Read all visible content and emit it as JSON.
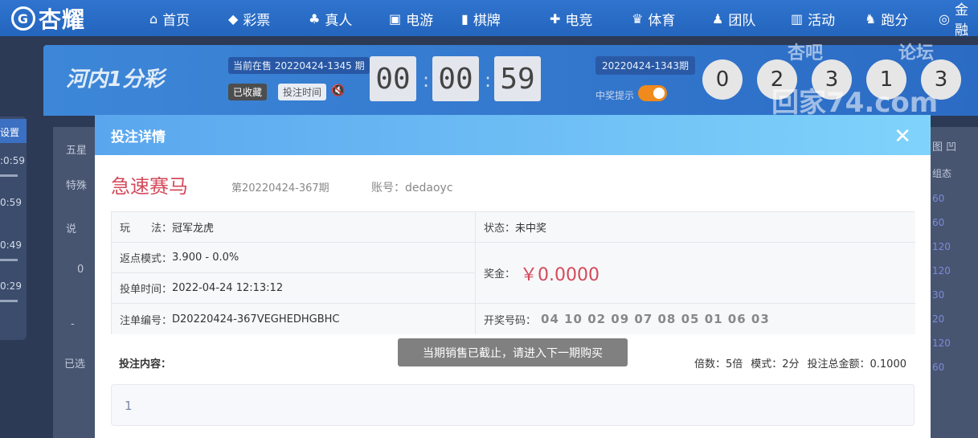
{
  "brand": {
    "logo_text": "杏耀"
  },
  "nav": [
    {
      "icon": "home-icon",
      "glyph": "⌂",
      "label": "首页"
    },
    {
      "icon": "ticket-icon",
      "glyph": "◆",
      "label": "彩票"
    },
    {
      "icon": "dealer-icon",
      "glyph": "♣",
      "label": "真人"
    },
    {
      "icon": "slot-icon",
      "glyph": "▣",
      "label": "电游"
    },
    {
      "icon": "card-icon",
      "glyph": "▮",
      "label": "棋牌"
    },
    {
      "icon": "gamepad-icon",
      "glyph": "✚",
      "label": "电竞"
    },
    {
      "icon": "trophy-icon",
      "glyph": "♛",
      "label": "体育"
    },
    {
      "icon": "team-icon",
      "glyph": "♟",
      "label": "团队"
    },
    {
      "icon": "gift-icon",
      "glyph": "▥",
      "label": "活动"
    },
    {
      "icon": "horse-icon",
      "glyph": "♞",
      "label": "跑分"
    },
    {
      "icon": "coin-icon",
      "glyph": "◎",
      "label": "金融"
    }
  ],
  "lottery_header": {
    "logo_text": "河内1分彩",
    "current_sale": "当前在售 20220424-1345 期",
    "favorited_label": "已收藏",
    "bet_time_label": "投注时间",
    "countdown": {
      "h": "00",
      "m": "00",
      "s": "59"
    },
    "last_issue": "20220424-1343期",
    "win_tip_label": "中奖提示",
    "balls": [
      "0",
      "2",
      "3",
      "1",
      "3"
    ]
  },
  "watermark": {
    "line1": "杏吧",
    "line2": "论坛",
    "line3": "回家74.com"
  },
  "background": {
    "left_title": "设置",
    "left_times": [
      ":0:59",
      "0:59",
      "0:49",
      "0:29"
    ],
    "tab_wuxing": "五星",
    "special": "特殊",
    "explain": "说",
    "zero": "0",
    "dash": "-",
    "selected": "已选",
    "right_title": "图 凹",
    "right_sub": "组态",
    "right_nums": [
      "60",
      "60",
      "120",
      "120",
      "30",
      "20",
      "120",
      "60"
    ]
  },
  "modal": {
    "title": "投注详情",
    "game_name": "急速赛马",
    "issue": "第20220424-367期",
    "account_label": "账号：",
    "account": "dedaoyc",
    "play_label": "玩　　法：",
    "play": "冠军龙虎",
    "status_label": "状态：",
    "status": "未中奖",
    "rebate_label": "返点模式：",
    "rebate": "3.900 - 0.0%",
    "prize_label": "奖金：",
    "prize": "￥0.0000",
    "bet_time_label": "投单时间：",
    "bet_time": "2022-04-24 12:13:12",
    "order_label": "注单编号：",
    "order_no": "D20220424-367VEGHEDHGBHC",
    "draw_label": "开奖号码：",
    "draw_numbers": "04 10 02 09 07 08 05 01 06 03",
    "content_label": "投注内容：",
    "multiple": "倍数：5倍",
    "mode": "模式：2分",
    "total": "投注总金额：0.1000",
    "content": "1"
  },
  "toast": "当期销售已截止，请进入下一期购买"
}
